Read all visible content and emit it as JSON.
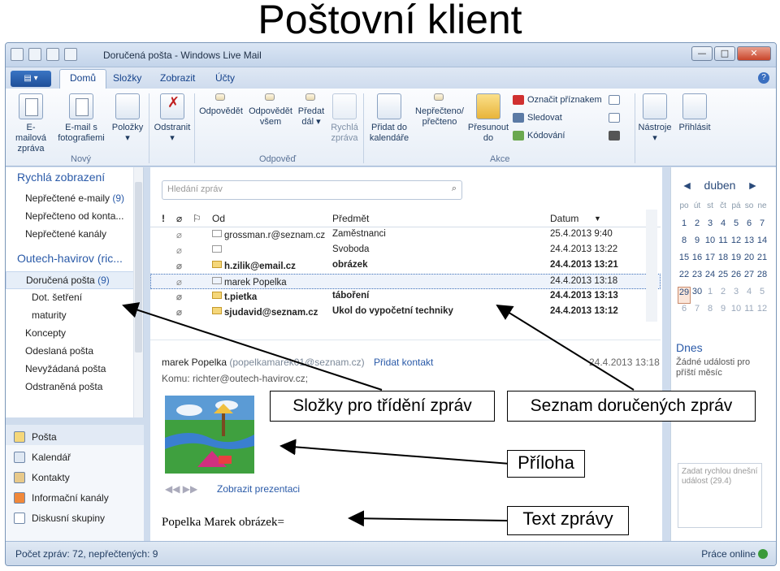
{
  "slide_title": "Poštovní klient",
  "window": {
    "title": "Doručená pošta - Windows Live Mail",
    "controls": {
      "minimize": "—",
      "maximize": "□",
      "close": "✕"
    }
  },
  "tabs": [
    "Domů",
    "Složky",
    "Zobrazit",
    "Účty"
  ],
  "ribbon": {
    "new_group": "Nový",
    "reply_group": "Odpověď",
    "actions_group": "Akce",
    "email": [
      "E-mailová",
      "zpráva"
    ],
    "photo_email": [
      "E-mail s",
      "fotografiemi"
    ],
    "items": [
      "Položky",
      "▾"
    ],
    "delete": [
      "Odstranit",
      "▾"
    ],
    "reply": "Odpovědět",
    "reply_all": [
      "Odpovědět",
      "všem"
    ],
    "forward": [
      "Předat",
      "dál ▾"
    ],
    "im_reply": [
      "Rychlá",
      "zpráva"
    ],
    "add_calendar": [
      "Přidat do",
      "kalendáře"
    ],
    "unread": [
      "Nepřečteno/",
      "přečteno"
    ],
    "move_to": [
      "Přesunout",
      "do"
    ],
    "flag": "Označit příznakem",
    "watch": "Sledovat",
    "encoding": "Kódování",
    "tools": [
      "Nástroje",
      "▾"
    ],
    "sign_in": "Přihlásit"
  },
  "sidebar": {
    "quick_views": "Rychlá zobrazení",
    "quick_items": [
      {
        "label": "Nepřečtené e-maily",
        "count": "(9)"
      },
      {
        "label": "Nepřečteno od konta...",
        "count": ""
      },
      {
        "label": "Nepřečtené kanály",
        "count": ""
      }
    ],
    "account": "Outech-havirov (ric...",
    "folders": [
      {
        "label": "Doručená pošta",
        "count": "(9)"
      },
      {
        "label": "Dot. šetření",
        "count": ""
      },
      {
        "label": "maturity",
        "count": ""
      },
      {
        "label": "Koncepty",
        "count": ""
      },
      {
        "label": "Odeslaná pošta",
        "count": ""
      },
      {
        "label": "Nevyžádaná pošta",
        "count": ""
      },
      {
        "label": "Odstraněná pošta",
        "count": ""
      }
    ]
  },
  "navpane": [
    "Pošta",
    "Kalendář",
    "Kontakty",
    "Informační kanály",
    "Diskusní skupiny"
  ],
  "search": {
    "placeholder": "Hledání zpráv"
  },
  "list_headers": {
    "from": "Od",
    "subject": "Předmět",
    "date": "Datum",
    "sort": "▼"
  },
  "messages": [
    {
      "from": "grossman.r@seznam.cz",
      "subject": "Zaměstnanci",
      "date": "25.4.2013 9:40"
    },
    {
      "from": "",
      "subject": "Svoboda",
      "date": "24.4.2013 13:22"
    },
    {
      "from": "h.zilik@email.cz",
      "subject": "obrázek",
      "date": "24.4.2013 13:21"
    },
    {
      "from": "marek Popelka",
      "subject": "",
      "date": "24.4.2013 13:18"
    },
    {
      "from": "t.pietka",
      "subject": "táboření",
      "date": "24.4.2013 13:13"
    },
    {
      "from": "sjudavid@seznam.cz",
      "subject": "Ukol do vypočetní techniky",
      "date": "24.4.2013 13:12"
    }
  ],
  "preview": {
    "from_name": "marek Popelka",
    "from_email": "(popelkamarek01@seznam.cz)",
    "add_contact": "Přidat kontakt",
    "date": "24.4.2013 13:18",
    "to": "Komu: richter@outech-havirov.cz;",
    "arrows": "◀◀   ▶▶",
    "show_presentation": "Zobrazit prezentaci",
    "body": "Popelka Marek obrázek="
  },
  "calendar": {
    "month": "duben",
    "prev": "◄",
    "next": "►",
    "dow": [
      "po",
      "út",
      "st",
      "čt",
      "pá",
      "so",
      "ne"
    ],
    "weeks": [
      [
        "1",
        "2",
        "3",
        "4",
        "5",
        "6",
        "7"
      ],
      [
        "8",
        "9",
        "10",
        "11",
        "12",
        "13",
        "14"
      ],
      [
        "15",
        "16",
        "17",
        "18",
        "19",
        "20",
        "21"
      ],
      [
        "22",
        "23",
        "24",
        "25",
        "26",
        "27",
        "28"
      ],
      [
        "29",
        "30",
        "1",
        "2",
        "3",
        "4",
        "5"
      ],
      [
        "6",
        "7",
        "8",
        "9",
        "10",
        "11",
        "12"
      ]
    ],
    "today_label": "Dnes",
    "no_events": "Žádné události pro příští měsíc",
    "quick_event": "Zadat rychlou dnešní událost (29.4)"
  },
  "status": {
    "left": "Počet zpráv: 72, nepřečtených: 9",
    "right": "Práce online"
  },
  "callouts": {
    "folders": "Složky pro třídění zpráv",
    "list": "Seznam doručených zpráv",
    "attachment": "Příloha",
    "body": "Text zprávy"
  }
}
